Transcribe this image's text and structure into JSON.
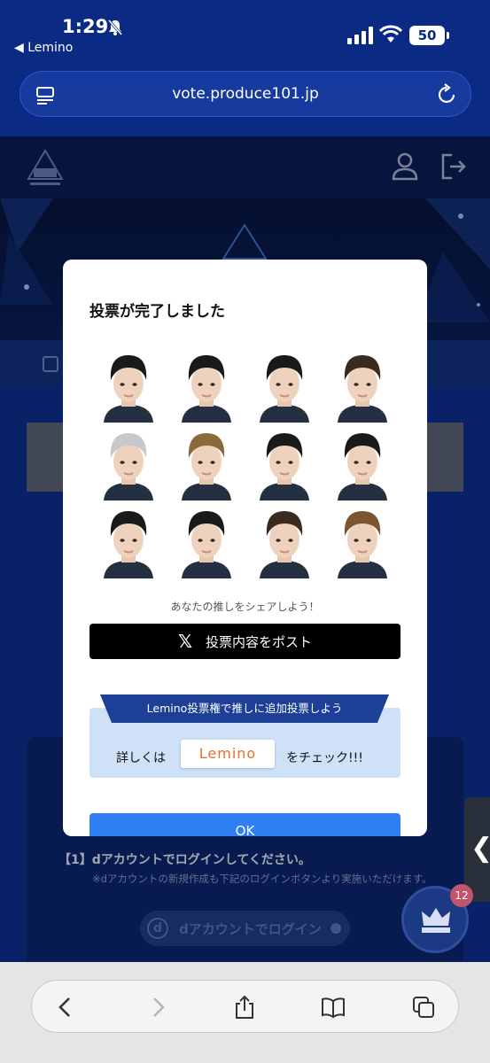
{
  "status": {
    "time": "1:29",
    "back_app": "◀ Lemino",
    "battery": "50"
  },
  "browser": {
    "url": "vote.produce101.jp"
  },
  "modal": {
    "title": "投票が完了しました",
    "share_text": "あなたの推しをシェアしよう！",
    "post_button": "投票内容をポスト",
    "promo_heading": "Lemino投票権で推しに追加投票しよう",
    "promo_prefix": "詳しくは",
    "promo_logo": "Lemino",
    "promo_suffix": "をチェック!!!",
    "ok_button": "OK"
  },
  "background_page": {
    "step_title": "【1】dアカウントでログインしてください。",
    "step_note": "※dアカウントの新規作成も下記のログインボタンより実施いただけます。",
    "login_button": "dアカウントでログイン",
    "login_icon_letter": "d",
    "badge_count": "12"
  },
  "colors": {
    "accent": "#2f7ef2",
    "navy": "#1d3f95",
    "promo_bg": "#cfe1f7"
  }
}
